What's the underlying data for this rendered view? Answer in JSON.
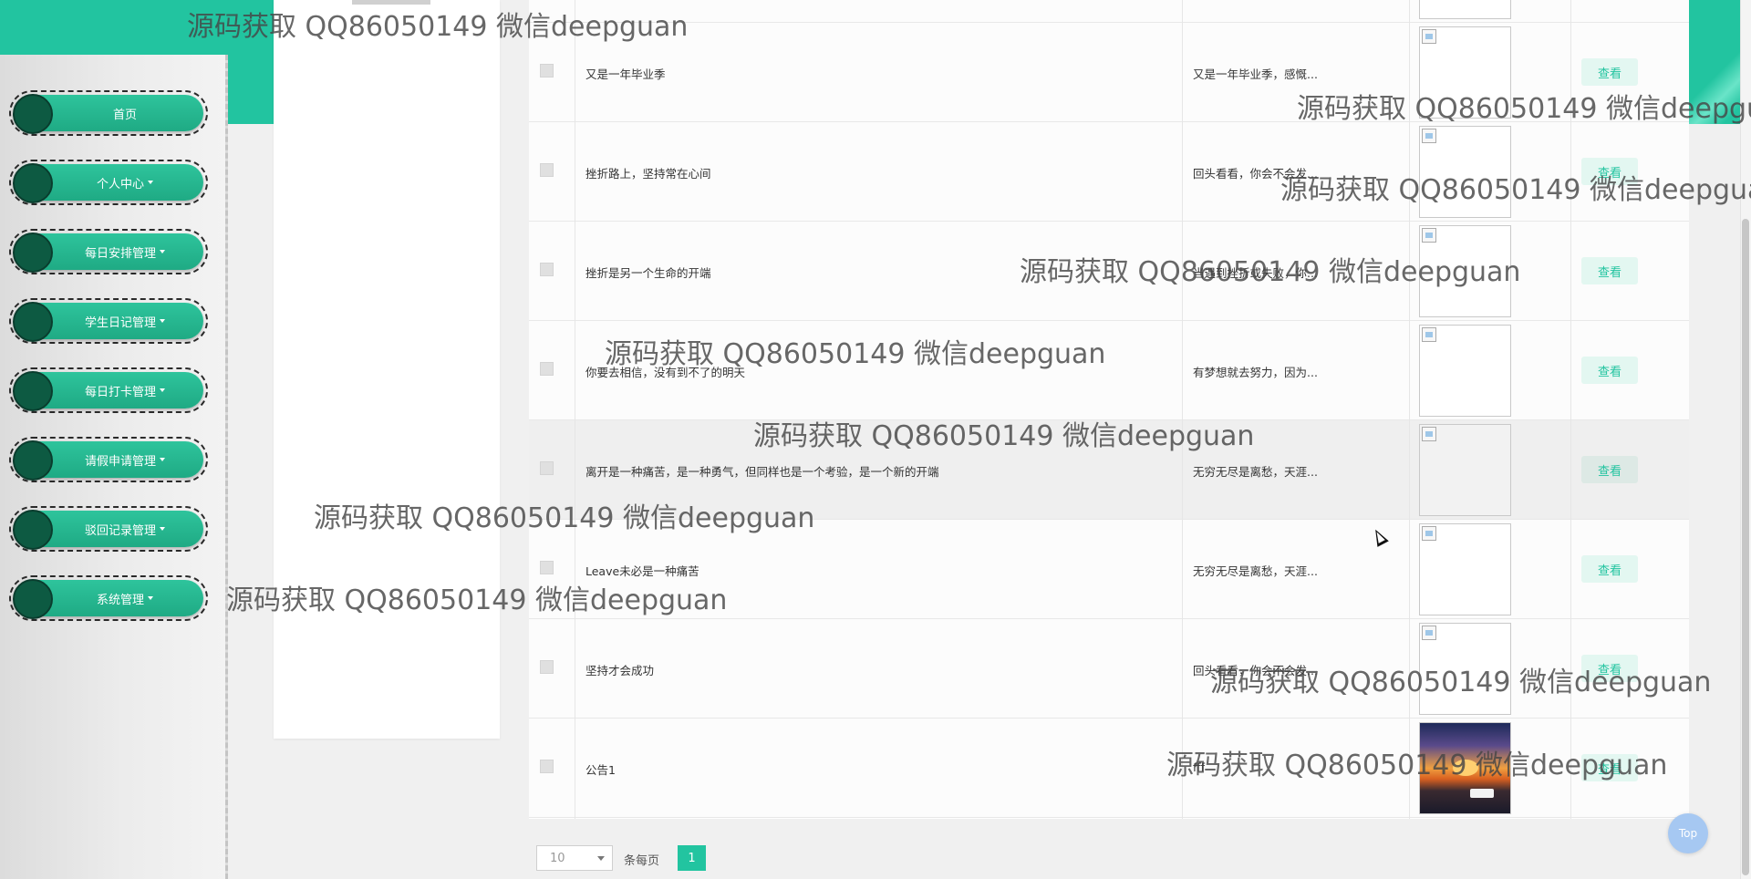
{
  "sidebar": {
    "items": [
      {
        "label": "首页",
        "has_caret": false
      },
      {
        "label": "个人中心",
        "has_caret": true
      },
      {
        "label": "每日安排管理",
        "has_caret": true
      },
      {
        "label": "学生日记管理",
        "has_caret": true
      },
      {
        "label": "每日打卡管理",
        "has_caret": true
      },
      {
        "label": "请假申请管理",
        "has_caret": true
      },
      {
        "label": "驳回记录管理",
        "has_caret": true
      },
      {
        "label": "系统管理",
        "has_caret": true
      }
    ]
  },
  "table": {
    "rows": [
      {
        "title": "又是一年毕业季",
        "summary": "又是一年毕业季，感慨...",
        "image": "broken",
        "action": "查看"
      },
      {
        "title": "挫折路上，坚持常在心间",
        "summary": "回头看看，你会不会发...",
        "image": "broken",
        "action": "查看"
      },
      {
        "title": "挫折是另一个生命的开端",
        "summary": "当遇到挫折或失败，你...",
        "image": "broken",
        "action": "查看"
      },
      {
        "title": "你要去相信，没有到不了的明天",
        "summary": "有梦想就去努力，因为...",
        "image": "broken",
        "action": "查看"
      },
      {
        "title": "离开是一种痛苦，是一种勇气，但同样也是一个考验，是一个新的开端",
        "summary": "无穷无尽是离愁，天涯...",
        "image": "broken",
        "action": "查看"
      },
      {
        "title": "Leave未必是一种痛苦",
        "summary": "无穷无尽是离愁，天涯...",
        "image": "broken",
        "action": "查看"
      },
      {
        "title": "坚持才会成功",
        "summary": "回头看看，你会不会发...",
        "image": "broken",
        "action": "查看"
      },
      {
        "title": "公告1",
        "summary": "fff",
        "image": "photo",
        "action": "查看"
      }
    ]
  },
  "pagination": {
    "page_size": "10",
    "per_page_label": "条每页",
    "current_page": "1"
  },
  "back_to_top": "Top",
  "watermark": "源码获取 QQ86050149 微信deepguan",
  "colors": {
    "accent": "#22c4a0",
    "nav_knob": "#0d5a42",
    "view_button_bg": "#e3f7f1",
    "top_button": "#a6c8f2"
  },
  "icons": [
    "checkbox-icon",
    "broken-image-icon",
    "caret-down-icon",
    "mouse-cursor-icon"
  ]
}
